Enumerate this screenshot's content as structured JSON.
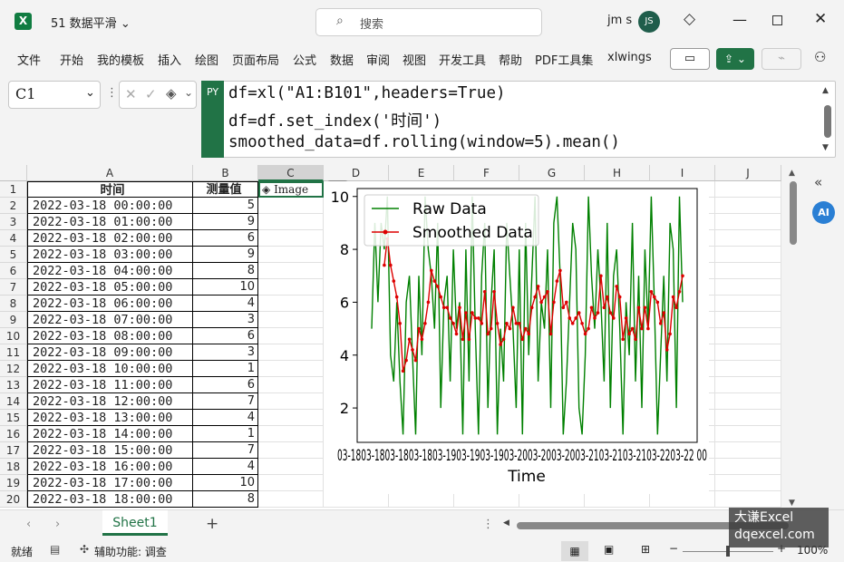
{
  "titlebar": {
    "app_icon": "excel-icon",
    "file_name": "51 数据平滑",
    "search_placeholder": "搜索",
    "user_name": "jm s",
    "user_initials": "JS"
  },
  "menu": [
    "文件",
    "开始",
    "我的模板",
    "插入",
    "绘图",
    "页面布局",
    "公式",
    "数据",
    "审阅",
    "视图",
    "开发工具",
    "帮助",
    "PDF工具集",
    "xlwings"
  ],
  "formula_bar": {
    "name_box": "C1",
    "py_tag": "PY",
    "code": [
      "df=xl(\"A1:B101\",headers=True)",
      "df=df.set_index('时间')",
      "smoothed_data=df.rolling(window=5).mean()"
    ]
  },
  "grid": {
    "columns": [
      "A",
      "B",
      "C",
      "D",
      "E",
      "F",
      "G",
      "H",
      "I",
      "J"
    ],
    "row_numbers": [
      "1",
      "2",
      "3",
      "4",
      "5",
      "6",
      "7",
      "8",
      "9",
      "10",
      "11",
      "12",
      "13",
      "14",
      "15",
      "16",
      "17",
      "18",
      "19",
      "20"
    ],
    "header": {
      "time": "时间",
      "value": "测量值",
      "image_cell": "Image"
    },
    "rows": [
      {
        "time": "2022-03-18 00:00:00",
        "value": "5"
      },
      {
        "time": "2022-03-18 01:00:00",
        "value": "9"
      },
      {
        "time": "2022-03-18 02:00:00",
        "value": "6"
      },
      {
        "time": "2022-03-18 03:00:00",
        "value": "9"
      },
      {
        "time": "2022-03-18 04:00:00",
        "value": "8"
      },
      {
        "time": "2022-03-18 05:00:00",
        "value": "10"
      },
      {
        "time": "2022-03-18 06:00:00",
        "value": "4"
      },
      {
        "time": "2022-03-18 07:00:00",
        "value": "3"
      },
      {
        "time": "2022-03-18 08:00:00",
        "value": "6"
      },
      {
        "time": "2022-03-18 09:00:00",
        "value": "3"
      },
      {
        "time": "2022-03-18 10:00:00",
        "value": "1"
      },
      {
        "time": "2022-03-18 11:00:00",
        "value": "6"
      },
      {
        "time": "2022-03-18 12:00:00",
        "value": "7"
      },
      {
        "time": "2022-03-18 13:00:00",
        "value": "4"
      },
      {
        "time": "2022-03-18 14:00:00",
        "value": "1"
      },
      {
        "time": "2022-03-18 15:00:00",
        "value": "7"
      },
      {
        "time": "2022-03-18 16:00:00",
        "value": "4"
      },
      {
        "time": "2022-03-18 17:00:00",
        "value": "10"
      },
      {
        "time": "2022-03-18 18:00:00",
        "value": "8"
      }
    ]
  },
  "chart_data": {
    "type": "line",
    "xlabel": "Time",
    "x_tick_text": "03-1803-1803-1803-1803-1903-1903-1903-2003-2003-2003-2103-2103-2103-2203-22 00",
    "y_ticks": [
      "2",
      "4",
      "6",
      "8",
      "10"
    ],
    "ylim": [
      0.7,
      10.3
    ],
    "legend_placement": "top-left",
    "series": [
      {
        "name": "Raw Data",
        "color": "#008000",
        "values": [
          5,
          9,
          6,
          9,
          8,
          10,
          4,
          3,
          6,
          3,
          1,
          6,
          7,
          4,
          1,
          7,
          4,
          10,
          8,
          7,
          5,
          9,
          2,
          6,
          7,
          3,
          8,
          5,
          6,
          1,
          8,
          3,
          10,
          5,
          1,
          7,
          9,
          2,
          6,
          8,
          1,
          5,
          3,
          9,
          7,
          5,
          2,
          8,
          1,
          9,
          4,
          7,
          10,
          3,
          6,
          5,
          8,
          2,
          9,
          10,
          7,
          1,
          3,
          6,
          9,
          8,
          2,
          1,
          4,
          10,
          7,
          5,
          8,
          6,
          3,
          9,
          2,
          7,
          8,
          5,
          1,
          6,
          4,
          9,
          3,
          7,
          2,
          8,
          5,
          10,
          6,
          1,
          4,
          7,
          3,
          9,
          8,
          2,
          10,
          6
        ]
      },
      {
        "name": "Smoothed Data",
        "color": "#dd0000",
        "values": [
          null,
          null,
          null,
          null,
          7.4,
          8.4,
          7.4,
          6.8,
          6.2,
          5.2,
          3.4,
          3.8,
          4.6,
          4.2,
          3.8,
          5.0,
          4.6,
          5.2,
          6.0,
          7.2,
          6.8,
          6.6,
          6.2,
          5.8,
          5.8,
          5.4,
          5.2,
          4.8,
          5.8,
          4.6,
          5.6,
          4.6,
          5.6,
          5.4,
          5.4,
          5.2,
          6.4,
          4.8,
          5.0,
          6.4,
          5.2,
          4.4,
          4.6,
          5.2,
          5.0,
          5.8,
          5.2,
          5.2,
          4.6,
          5.0,
          4.8,
          5.8,
          6.2,
          6.6,
          6.0,
          6.2,
          6.4,
          4.8,
          6.0,
          6.8,
          7.2,
          5.8,
          6.0,
          5.4,
          5.2,
          5.4,
          5.6,
          5.2,
          4.8,
          5.0,
          5.8,
          5.4,
          5.6,
          7.0,
          5.8,
          6.2,
          5.6,
          5.4,
          6.6,
          6.2,
          4.6,
          5.4,
          4.8,
          5.0,
          4.6,
          5.8,
          5.0,
          5.8,
          5.0,
          6.4,
          6.2,
          6.0,
          5.2,
          5.6,
          4.2,
          4.8,
          6.2,
          5.8,
          6.4,
          7.0
        ]
      }
    ]
  },
  "sheets": {
    "active": "Sheet1"
  },
  "status": {
    "ready": "就绪",
    "accessibility": "辅助功能: 调查",
    "zoom": "100%"
  },
  "watermark": {
    "line1": "大谦Excel",
    "line2": "dqexcel.com"
  }
}
